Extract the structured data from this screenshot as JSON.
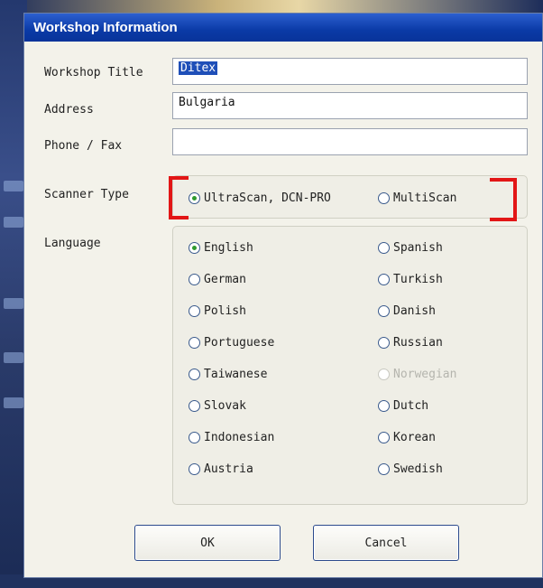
{
  "window": {
    "title": "Workshop Information"
  },
  "form": {
    "workshop_title_label": "Workshop Title",
    "workshop_title_value": "Ditex",
    "address_label": "Address",
    "address_value": "Bulgaria",
    "phone_label": "Phone / Fax",
    "phone_value": ""
  },
  "scanner": {
    "label": "Scanner Type",
    "options": [
      {
        "label": "UltraScan, DCN-PRO",
        "selected": true
      },
      {
        "label": "MultiScan",
        "selected": false
      }
    ]
  },
  "language": {
    "label": "Language",
    "options": [
      {
        "label": "English",
        "selected": true,
        "enabled": true
      },
      {
        "label": "Spanish",
        "selected": false,
        "enabled": true
      },
      {
        "label": "German",
        "selected": false,
        "enabled": true
      },
      {
        "label": "Turkish",
        "selected": false,
        "enabled": true
      },
      {
        "label": "Polish",
        "selected": false,
        "enabled": true
      },
      {
        "label": "Danish",
        "selected": false,
        "enabled": true
      },
      {
        "label": "Portuguese",
        "selected": false,
        "enabled": true
      },
      {
        "label": "Russian",
        "selected": false,
        "enabled": true
      },
      {
        "label": "Taiwanese",
        "selected": false,
        "enabled": true
      },
      {
        "label": "Norwegian",
        "selected": false,
        "enabled": false
      },
      {
        "label": "Slovak",
        "selected": false,
        "enabled": true
      },
      {
        "label": "Dutch",
        "selected": false,
        "enabled": true
      },
      {
        "label": "Indonesian",
        "selected": false,
        "enabled": true
      },
      {
        "label": "Korean",
        "selected": false,
        "enabled": true
      },
      {
        "label": "Austria",
        "selected": false,
        "enabled": true
      },
      {
        "label": "Swedish",
        "selected": false,
        "enabled": true
      }
    ]
  },
  "buttons": {
    "ok": "OK",
    "cancel": "Cancel"
  },
  "colors": {
    "titlebar": "#0a3aa6",
    "highlight_bracket": "#e21616",
    "radio_selected": "#2f9a2f"
  }
}
